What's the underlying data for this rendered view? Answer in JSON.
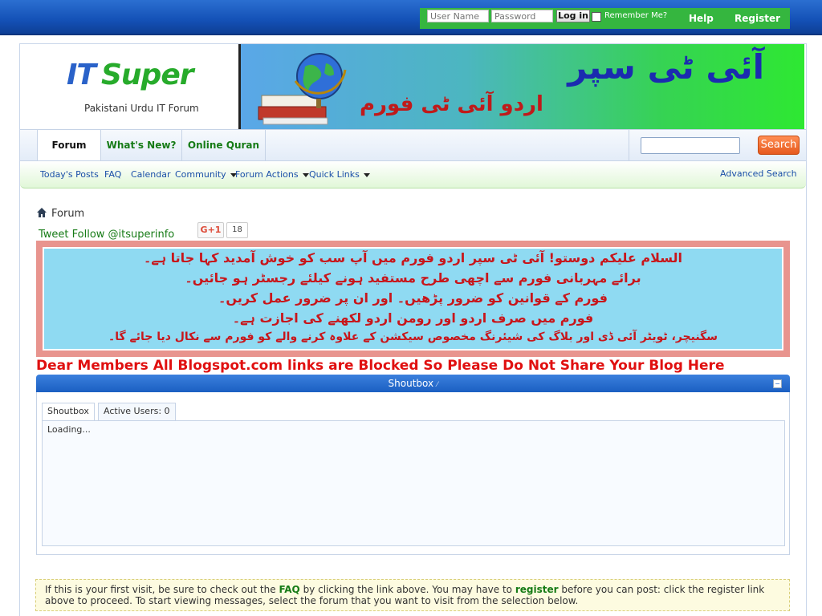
{
  "login": {
    "username_placeholder": "User Name",
    "password_placeholder": "Password",
    "login_button": "Log in",
    "remember_label": "Remember Me?",
    "help_link": "Help",
    "register_link": "Register"
  },
  "header": {
    "logo_it": "IT",
    "logo_super": "Super",
    "tagline": "Pakistani Urdu IT Forum",
    "banner_title": "آئی ٹی سپر",
    "banner_subtitle": "اردو آئی ٹی فورم"
  },
  "nav": {
    "tabs": [
      {
        "label": "Forum"
      },
      {
        "label": "What's New?"
      },
      {
        "label": "Online Quran"
      }
    ],
    "search_button": "Search"
  },
  "subnav": {
    "links": [
      {
        "label": "Today's Posts"
      },
      {
        "label": "FAQ"
      },
      {
        "label": "Calendar"
      },
      {
        "label": "Community"
      },
      {
        "label": "Forum Actions"
      },
      {
        "label": "Quick Links"
      }
    ],
    "advanced_search": "Advanced Search"
  },
  "breadcrumb": {
    "current": "Forum"
  },
  "social": {
    "tweet_follow": "Tweet Follow @itsuperinfo",
    "gplus_label": "G+1",
    "gplus_count": "18"
  },
  "notice_lines": [
    "السلام علیکم دوستو! آئی ٹی سپر اردو فورم میں آپ سب کو خوش آمدید کہا جاتا ہے۔",
    "برائے مہربانی فورم سے اچھی طرح مستفید ہونے کیلئے رجسٹر ہو جائیں۔",
    "فورم کے قوانین کو ضرور پڑھیں۔ اور ان پر ضرور عمل کریں۔",
    "فورم میں صرف اردو اور رومن اردو لکھنے کی اجازت ہے۔",
    "سگنیچر، ٹویٹر آئی ڈی اور بلاگ کی شیئرنگ مخصوص سیکشن کے علاوہ کرنے والے کو فورم سے نکال دیا جائے گا۔"
  ],
  "blog_notice": "Dear Members All Blogspot.com links are Blocked So Please Do Not Share Your Blog Here",
  "shoutbox": {
    "title": "Shoutbox",
    "tab_shoutbox": "Shoutbox",
    "tab_active_users": "Active Users: 0",
    "loading": "Loading..."
  },
  "welcome": {
    "text_1": "If this is your first visit, be sure to check out the ",
    "faq": "FAQ",
    "text_2": " by clicking the link above. You may have to ",
    "register": "register",
    "text_3": " before you can post: click the register link above to proceed. To start viewing messages, select the forum that you want to visit from the selection below."
  },
  "colors": {
    "top_bar": "#1451b6",
    "login_bar": "#35b63f",
    "link_green": "#167b16",
    "alert_red": "#e01010",
    "search_orange": "#e6591d"
  }
}
